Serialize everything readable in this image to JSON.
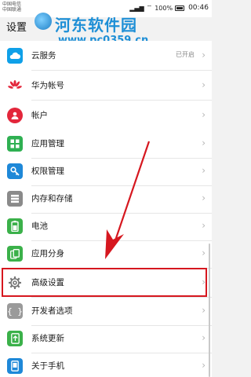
{
  "status": {
    "carrier1": "中国电信",
    "carrier2": "中国联通",
    "battery": "100%",
    "time": "00:46"
  },
  "header": {
    "title": "设置"
  },
  "watermark": {
    "text": "河东软件园",
    "url": "www.pc0359.cn"
  },
  "groups": [
    {
      "items": [
        {
          "label": "云服务",
          "value": "已开启",
          "icon": "cloud-icon",
          "color": "#0fa0e8"
        },
        {
          "label": "华为帐号",
          "icon": "huawei-icon",
          "color": "#e3263b"
        },
        {
          "label": "帐户",
          "icon": "account-icon",
          "color": "#e3263b"
        }
      ]
    },
    {
      "items": [
        {
          "label": "应用管理",
          "icon": "apps-icon",
          "color": "#2fb052"
        },
        {
          "label": "权限管理",
          "icon": "key-icon",
          "color": "#1e88d8"
        },
        {
          "label": "内存和存储",
          "icon": "storage-icon",
          "color": "#8a8a8a"
        },
        {
          "label": "电池",
          "icon": "battery-icon",
          "color": "#3bb14a"
        },
        {
          "label": "应用分身",
          "icon": "app-twin-icon",
          "color": "#3bb14a"
        },
        {
          "label": "高级设置",
          "icon": "gear-icon",
          "color": "#8a8a8a"
        },
        {
          "label": "开发者选项",
          "icon": "braces-icon",
          "color": "#9a9a9a"
        },
        {
          "label": "系统更新",
          "icon": "update-icon",
          "color": "#3bb14a"
        },
        {
          "label": "关于手机",
          "icon": "phone-icon",
          "color": "#1e88d8"
        }
      ]
    }
  ],
  "colors": {
    "highlight": "#d6171f",
    "arrow": "#d6171f"
  }
}
